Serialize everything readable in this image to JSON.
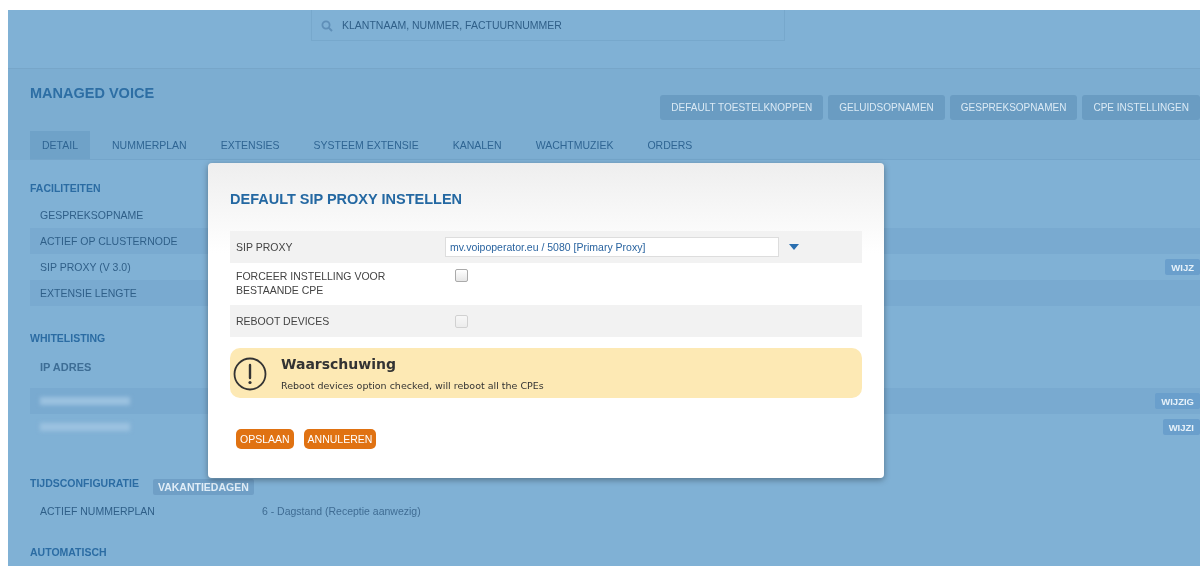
{
  "search": {
    "placeholder": "KLANTNAAM, NUMMER, FACTUURNUMMER"
  },
  "section_title": "MANAGED VOICE",
  "action_buttons": [
    "DEFAULT TOESTELKNOPPEN",
    "GELUIDSOPNAMEN",
    "GESPREKSOPNAMEN",
    "CPE INSTELLINGEN"
  ],
  "tabs": [
    {
      "label": "DETAIL",
      "selected": true
    },
    {
      "label": "NUMMERPLAN",
      "selected": false
    },
    {
      "label": "EXTENSIES",
      "selected": false
    },
    {
      "label": "SYSTEEM EXTENSIE",
      "selected": false
    },
    {
      "label": "KANALEN",
      "selected": false
    },
    {
      "label": "WACHTMUZIEK",
      "selected": false
    },
    {
      "label": "ORDERS",
      "selected": false
    }
  ],
  "faciliteiten": {
    "title": "FACILITEITEN",
    "rows": [
      {
        "label": "GESPREKSOPNAME"
      },
      {
        "label": "ACTIEF OP CLUSTERNODE"
      },
      {
        "label": "SIP PROXY (V 3.0)",
        "action": "WIJZ"
      },
      {
        "label": "EXTENSIE LENGTE"
      }
    ]
  },
  "whitelisting": {
    "title": "WHITELISTING",
    "column": "IP ADRES",
    "rows": [
      {
        "action": "WIJZIG"
      },
      {
        "action": "WIJZI"
      }
    ]
  },
  "tijdsconfiguratie": {
    "title": "TIJDSCONFIGURATIE",
    "tag": "VAKANTIEDAGEN",
    "rows": [
      {
        "label": "ACTIEF NUMMERPLAN",
        "value": "6 - Dagstand (Receptie aanwezig)"
      }
    ]
  },
  "automatisch": {
    "title": "AUTOMATISCH"
  },
  "modal": {
    "title": "DEFAULT SIP PROXY INSTELLEN",
    "fields": [
      {
        "kind": "select",
        "label": "SIP PROXY",
        "value": "mv.voipoperator.eu / 5080 [Primary Proxy]"
      },
      {
        "kind": "checkbox",
        "label": "FORCEER INSTELLING VOOR BESTAANDE CPE",
        "checked": false,
        "disabled": false
      },
      {
        "kind": "checkbox",
        "label": "REBOOT DEVICES",
        "checked": false,
        "disabled": true
      }
    ],
    "warning": {
      "title": "Waarschuwing",
      "message": "Reboot devices option checked, will reboot all the CPEs"
    },
    "buttons": [
      "OPSLAAN",
      "ANNULEREN"
    ]
  }
}
